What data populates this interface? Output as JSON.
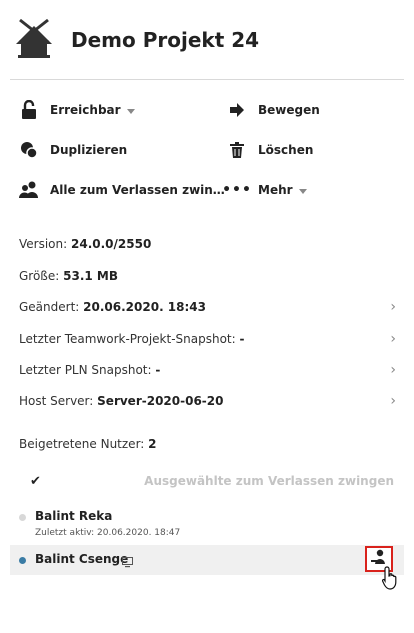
{
  "project": {
    "title": "Demo Projekt 24"
  },
  "actions": {
    "reachable": "Erreichbar",
    "move": "Bewegen",
    "duplicate": "Duplizieren",
    "delete": "Löschen",
    "force_leave_all": "Alle zum Verlassen zwin…",
    "more": "Mehr"
  },
  "info": {
    "version_label": "Version:",
    "version_value": "24.0.0/2550",
    "size_label": "Größe:",
    "size_value": "53.1 MB",
    "changed_label": "Geändert:",
    "changed_value": "20.06.2020. 18:43",
    "teamwork_label": "Letzter Teamwork-Projekt-Snapshot:",
    "teamwork_value": "-",
    "pln_label": "Letzter PLN Snapshot:",
    "pln_value": "-",
    "host_label": "Host Server:",
    "host_value": "Server-2020-06-20"
  },
  "users": {
    "joined_label": "Beigetretene Nutzer:",
    "joined_count": "2",
    "select_all_glyph": "✔",
    "force_selected": "Ausgewählte zum Verlassen zwingen",
    "list": [
      {
        "name": "Balint Reka",
        "sub": "Zuletzt aktiv: 20.06.2020. 18:47",
        "status_color": "#d8d8d8"
      },
      {
        "name": "Balint Csenge",
        "status_color": "#3a7ca5"
      }
    ]
  },
  "icons": {
    "header": "home-icon",
    "reachable": "unlock-icon",
    "move": "arrow-right-icon",
    "duplicate": "duplicate-icon",
    "delete": "trash-icon",
    "force_leave_all": "users-icon",
    "more": "ellipsis-icon",
    "computer": "computer-icon",
    "force_user": "user-force-icon",
    "cursor": "hand-cursor-icon"
  },
  "colors": {
    "accent_red": "#d9221c",
    "status_online": "#3a7ca5",
    "disabled_text": "#c4c4c4"
  }
}
